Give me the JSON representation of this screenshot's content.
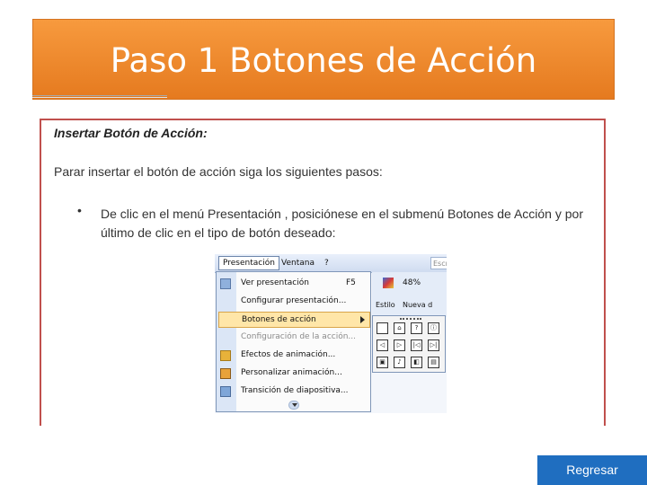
{
  "title": "Paso 1 Botones de Acción",
  "content": {
    "heading": "Insertar Botón de Acción:",
    "intro": "Parar insertar el botón de acción siga los siguientes pasos:",
    "bullet_symbol": "•",
    "bullet_text": "De clic en el menú Presentación , posiciónese en el submenú Botones de Acción y por último de clic en el tipo de botón deseado:"
  },
  "screenshot": {
    "menubar": {
      "presentacion": "Presentación",
      "ventana": "Ventana",
      "help": "?",
      "search": "Escr"
    },
    "menu_items": [
      {
        "label": "Ver presentación",
        "shortcut": "F5"
      },
      {
        "label": "Configurar presentación..."
      },
      {
        "label": "Botones de acción"
      },
      {
        "label": "Configuración de la acción..."
      },
      {
        "label": "Efectos de animación..."
      },
      {
        "label": "Personalizar animación..."
      },
      {
        "label": "Transición de diapositiva..."
      }
    ],
    "toolbar": {
      "zoom": "48%",
      "estilo": "Estilo",
      "nueva": "Nueva d"
    },
    "action_buttons": [
      "",
      "⌂",
      "?",
      "ⓘ",
      "◁",
      "▷",
      "|◁",
      "▷|",
      "▣",
      "♪",
      "◧",
      "▤"
    ]
  },
  "footer": {
    "regresar": "Regresar"
  }
}
